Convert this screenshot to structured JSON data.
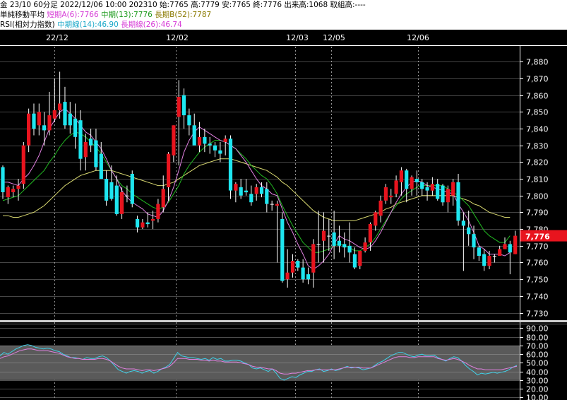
{
  "header": {
    "info": "金 23/10 60分足 2022/12/06 10:00 202310 始:7765 高:7779 安:7765 終:7776 出来高:1068 取組高:----",
    "ma_label": "単純移動平均",
    "ma_short": "短期A(6):7766",
    "ma_mid": "中期(13):7776",
    "ma_long": "長期B(52):7787",
    "rsi_label": "RSI(相対力指数)",
    "rsi_mid": "中期線(14):46.90",
    "rsi_long": "長期線(26):46.74"
  },
  "colors": {
    "up": "#e8141e",
    "down": "#1ee6f0",
    "ma_short": "#e080e0",
    "ma_mid": "#22b822",
    "ma_long": "#d8d870",
    "rsi_mid": "#40d0e8",
    "rsi_long": "#e080e0",
    "price_tag": "#e8141e"
  },
  "chart_data": [
    {
      "type": "candlestick",
      "x_labels": [
        "22/12",
        "12/02",
        "12/03",
        "12/05",
        "12/06"
      ],
      "y_ticks": [
        "7,880",
        "7,870",
        "7,860",
        "7,850",
        "7,840",
        "7,830",
        "7,820",
        "7,810",
        "7,800",
        "7,790",
        "7,780",
        "7,770",
        "7,760",
        "7,750",
        "7,740",
        "7,730"
      ],
      "ylim": [
        7726,
        7889
      ],
      "last_price_label": "7,776",
      "last_price": 7776,
      "ohlc": [
        [
          7817,
          7818,
          7798,
          7802
        ],
        [
          7799,
          7806,
          7795,
          7805
        ],
        [
          7802,
          7806,
          7799,
          7804
        ],
        [
          7804,
          7810,
          7797,
          7806
        ],
        [
          7807,
          7832,
          7804,
          7830
        ],
        [
          7830,
          7852,
          7826,
          7849
        ],
        [
          7849,
          7855,
          7836,
          7840
        ],
        [
          7842,
          7855,
          7836,
          7850
        ],
        [
          7842,
          7850,
          7830,
          7839
        ],
        [
          7839,
          7862,
          7836,
          7848
        ],
        [
          7846,
          7870,
          7844,
          7851
        ],
        [
          7851,
          7874,
          7846,
          7855
        ],
        [
          7856,
          7865,
          7840,
          7842
        ],
        [
          7849,
          7856,
          7837,
          7842
        ],
        [
          7846,
          7855,
          7828,
          7835
        ],
        [
          7845,
          7851,
          7815,
          7822
        ],
        [
          7823,
          7837,
          7815,
          7832
        ],
        [
          7834,
          7840,
          7826,
          7830
        ],
        [
          7833,
          7840,
          7815,
          7817
        ],
        [
          7825,
          7832,
          7810,
          7810
        ],
        [
          7810,
          7815,
          7794,
          7797
        ],
        [
          7808,
          7818,
          7797,
          7798
        ],
        [
          7806,
          7812,
          7788,
          7789
        ],
        [
          7789,
          7805,
          7786,
          7802
        ],
        [
          7800,
          7806,
          7796,
          7800
        ],
        [
          7813,
          7815,
          7793,
          7795
        ],
        [
          7786,
          7788,
          7778,
          7781
        ],
        [
          7781,
          7786,
          7780,
          7784
        ],
        [
          7784,
          7790,
          7781,
          7783
        ],
        [
          7785,
          7791,
          7780,
          7786
        ],
        [
          7786,
          7798,
          7784,
          7795
        ],
        [
          7793,
          7812,
          7790,
          7804
        ],
        [
          7805,
          7826,
          7797,
          7825
        ],
        [
          7824,
          7842,
          7820,
          7842
        ],
        [
          7847,
          7869,
          7818,
          7859
        ],
        [
          7860,
          7864,
          7840,
          7848
        ],
        [
          7848,
          7852,
          7836,
          7842
        ],
        [
          7842,
          7849,
          7834,
          7830
        ],
        [
          7830,
          7844,
          7826,
          7835
        ],
        [
          7835,
          7840,
          7826,
          7831
        ],
        [
          7831,
          7835,
          7825,
          7830
        ],
        [
          7830,
          7832,
          7823,
          7827
        ],
        [
          7827,
          7832,
          7820,
          7825
        ],
        [
          7832,
          7836,
          7824,
          7834
        ],
        [
          7834,
          7836,
          7798,
          7803
        ],
        [
          7803,
          7808,
          7796,
          7807
        ],
        [
          7805,
          7810,
          7798,
          7800
        ],
        [
          7803,
          7810,
          7800,
          7802
        ],
        [
          7801,
          7806,
          7794,
          7796
        ],
        [
          7801,
          7807,
          7797,
          7805
        ],
        [
          7805,
          7808,
          7799,
          7801
        ],
        [
          7804,
          7808,
          7790,
          7795
        ],
        [
          7795,
          7797,
          7791,
          7795
        ],
        [
          7794,
          7797,
          7760,
          7795
        ],
        [
          7786,
          7790,
          7748,
          7749
        ],
        [
          7750,
          7768,
          7745,
          7754
        ],
        [
          7754,
          7765,
          7751,
          7761
        ],
        [
          7761,
          7762,
          7755,
          7757
        ],
        [
          7757,
          7762,
          7748,
          7750
        ],
        [
          7753,
          7757,
          7747,
          7750
        ],
        [
          7754,
          7774,
          7745,
          7771
        ],
        [
          7771,
          7791,
          7760,
          7771
        ],
        [
          7773,
          7790,
          7760,
          7779
        ],
        [
          7776,
          7786,
          7767,
          7776
        ],
        [
          7778,
          7791,
          7762,
          7770
        ],
        [
          7773,
          7782,
          7766,
          7770
        ],
        [
          7771,
          7778,
          7763,
          7769
        ],
        [
          7770,
          7784,
          7760,
          7766
        ],
        [
          7765,
          7769,
          7756,
          7757
        ],
        [
          7758,
          7764,
          7756,
          7767
        ],
        [
          7767,
          7775,
          7766,
          7772
        ],
        [
          7772,
          7784,
          7767,
          7783
        ],
        [
          7782,
          7791,
          7779,
          7790
        ],
        [
          7788,
          7800,
          7784,
          7797
        ],
        [
          7797,
          7807,
          7795,
          7805
        ],
        [
          7799,
          7804,
          7795,
          7800
        ],
        [
          7801,
          7812,
          7799,
          7809
        ],
        [
          7808,
          7817,
          7800,
          7815
        ],
        [
          7815,
          7816,
          7796,
          7804
        ],
        [
          7804,
          7812,
          7800,
          7811
        ],
        [
          7810,
          7815,
          7800,
          7808
        ],
        [
          7808,
          7810,
          7800,
          7804
        ],
        [
          7805,
          7808,
          7797,
          7803
        ],
        [
          7803,
          7811,
          7800,
          7807
        ],
        [
          7807,
          7810,
          7797,
          7798
        ],
        [
          7806,
          7807,
          7794,
          7796
        ],
        [
          7796,
          7806,
          7790,
          7804
        ],
        [
          7800,
          7810,
          7794,
          7808
        ],
        [
          7808,
          7813,
          7782,
          7785
        ],
        [
          7785,
          7790,
          7755,
          7782
        ],
        [
          7781,
          7791,
          7770,
          7777
        ],
        [
          7777,
          7782,
          7762,
          7769
        ],
        [
          7769,
          7770,
          7761,
          7764
        ],
        [
          7765,
          7768,
          7755,
          7758
        ],
        [
          7758,
          7767,
          7756,
          7764
        ],
        [
          7764,
          7765,
          7760,
          7764
        ],
        [
          7764,
          7770,
          7765,
          7768
        ],
        [
          7768,
          7775,
          7768,
          7771
        ],
        [
          7771,
          7773,
          7753,
          7766
        ],
        [
          7765,
          7779,
          7765,
          7776
        ]
      ],
      "ma_short": [
        7808,
        7808,
        7807,
        7806,
        7810,
        7813,
        7818,
        7824,
        7832,
        7840,
        7845,
        7850,
        7852,
        7849,
        7846,
        7842,
        7838,
        7836,
        7832,
        7828,
        7822,
        7815,
        7810,
        7803,
        7799,
        7796,
        7794,
        7792,
        7789,
        7788,
        7787,
        7791,
        7797,
        7805,
        7815,
        7826,
        7833,
        7838,
        7841,
        7839,
        7837,
        7835,
        7833,
        7832,
        7830,
        7828,
        7824,
        7820,
        7815,
        7810,
        7806,
        7804,
        7801,
        7800,
        7792,
        7784,
        7778,
        7771,
        7765,
        7758,
        7756,
        7758,
        7761,
        7765,
        7771,
        7776,
        7774,
        7773,
        7771,
        7769,
        7768,
        7769,
        7773,
        7778,
        7784,
        7790,
        7796,
        7801,
        7805,
        7808,
        7809,
        7808,
        7806,
        7805,
        7804,
        7803,
        7802,
        7801,
        7795,
        7790,
        7785,
        7778,
        7770,
        7768,
        7765,
        7765,
        7765,
        7764,
        7766
      ],
      "ma_mid": [
        7797,
        7798,
        7799,
        7800,
        7803,
        7806,
        7809,
        7812,
        7815,
        7820,
        7824,
        7829,
        7833,
        7836,
        7838,
        7837,
        7835,
        7832,
        7829,
        7825,
        7820,
        7815,
        7810,
        7806,
        7804,
        7801,
        7799,
        7797,
        7795,
        7793,
        7792,
        7793,
        7796,
        7801,
        7806,
        7813,
        7818,
        7822,
        7826,
        7829,
        7831,
        7833,
        7833,
        7832,
        7830,
        7828,
        7825,
        7822,
        7818,
        7815,
        7812,
        7810,
        7806,
        7801,
        7794,
        7788,
        7782,
        7777,
        7772,
        7769,
        7766,
        7766,
        7767,
        7768,
        7770,
        7771,
        7770,
        7769,
        7767,
        7767,
        7769,
        7771,
        7775,
        7780,
        7785,
        7790,
        7794,
        7798,
        7801,
        7803,
        7805,
        7806,
        7806,
        7806,
        7806,
        7806,
        7804,
        7802,
        7800,
        7797,
        7794,
        7789,
        7784,
        7779,
        7776,
        7774,
        7772,
        7772,
        7776
      ],
      "ma_long": [
        7788,
        7788,
        7787,
        7787,
        7788,
        7789,
        7790,
        7792,
        7794,
        7797,
        7800,
        7803,
        7806,
        7808,
        7810,
        7812,
        7813,
        7814,
        7815,
        7815,
        7815,
        7815,
        7814,
        7813,
        7812,
        7811,
        7810,
        7809,
        7808,
        7807,
        7806,
        7806,
        7807,
        7808,
        7810,
        7812,
        7814,
        7816,
        7818,
        7819,
        7820,
        7821,
        7822,
        7822,
        7822,
        7821,
        7820,
        7819,
        7818,
        7817,
        7816,
        7815,
        7813,
        7811,
        7808,
        7806,
        7803,
        7800,
        7797,
        7794,
        7791,
        7789,
        7787,
        7786,
        7785,
        7785,
        7785,
        7785,
        7785,
        7786,
        7787,
        7788,
        7789,
        7790,
        7792,
        7793,
        7795,
        7796,
        7797,
        7798,
        7799,
        7800,
        7800,
        7800,
        7800,
        7800,
        7800,
        7800,
        7799,
        7798,
        7797,
        7795,
        7794,
        7792,
        7790,
        7789,
        7788,
        7787,
        7787
      ]
    },
    {
      "type": "line",
      "title": "RSI",
      "y_ticks": [
        "90.00",
        "80.00",
        "70.00",
        "60.00",
        "50.00",
        "40.00",
        "30.00",
        "20.00",
        "10.00"
      ],
      "ylim": [
        7,
        92
      ],
      "band": [
        30,
        70
      ],
      "series": [
        {
          "name": "中期線(14)",
          "values": [
            58,
            62,
            60,
            63,
            66,
            68,
            70,
            71,
            70,
            68,
            67,
            66,
            67,
            66,
            64,
            63,
            60,
            58,
            56,
            56,
            55,
            54,
            56,
            55,
            55,
            57,
            58,
            56,
            52,
            47,
            42,
            40,
            38,
            40,
            41,
            40,
            38,
            40,
            41,
            38,
            40,
            43,
            45,
            48,
            55,
            62,
            58,
            57,
            56,
            56,
            55,
            54,
            55,
            53,
            56,
            54,
            55,
            52,
            52,
            53,
            53,
            52,
            50,
            48,
            44,
            43,
            44,
            42,
            40,
            43,
            38,
            32,
            30,
            32,
            34,
            33,
            36,
            38,
            40,
            40,
            42,
            43,
            40,
            41,
            43,
            41,
            42,
            44,
            46,
            44,
            45,
            44,
            42,
            43,
            44,
            47,
            50,
            52,
            55,
            58,
            60,
            62,
            62,
            60,
            58,
            57,
            59,
            60,
            58,
            58,
            59,
            56,
            54,
            52,
            55,
            57,
            56,
            52,
            47,
            43,
            40,
            36,
            38,
            37,
            38,
            39,
            38,
            39,
            40,
            42,
            45,
            47
          ]
        },
        {
          "name": "長期線(26)",
          "values": [
            55,
            57,
            58,
            60,
            62,
            64,
            65,
            66,
            66,
            65,
            64,
            64,
            64,
            63,
            62,
            61,
            59,
            57,
            56,
            55,
            55,
            54,
            54,
            54,
            54,
            55,
            55,
            54,
            52,
            49,
            46,
            44,
            43,
            43,
            43,
            42,
            41,
            42,
            42,
            41,
            42,
            43,
            44,
            46,
            50,
            55,
            55,
            55,
            54,
            54,
            54,
            53,
            53,
            52,
            53,
            52,
            52,
            51,
            51,
            51,
            51,
            50,
            49,
            48,
            46,
            45,
            45,
            44,
            43,
            43,
            41,
            38,
            37,
            37,
            38,
            38,
            39,
            40,
            41,
            41,
            42,
            42,
            42,
            42,
            42,
            42,
            43,
            44,
            45,
            45,
            45,
            45,
            44,
            44,
            44,
            46,
            48,
            50,
            52,
            54,
            56,
            57,
            57,
            57,
            56,
            56,
            57,
            57,
            57,
            57,
            57,
            55,
            54,
            53,
            54,
            55,
            54,
            52,
            50,
            47,
            45,
            43,
            43,
            42,
            42,
            42,
            42,
            42,
            43,
            44,
            45,
            46
          ]
        }
      ]
    }
  ]
}
